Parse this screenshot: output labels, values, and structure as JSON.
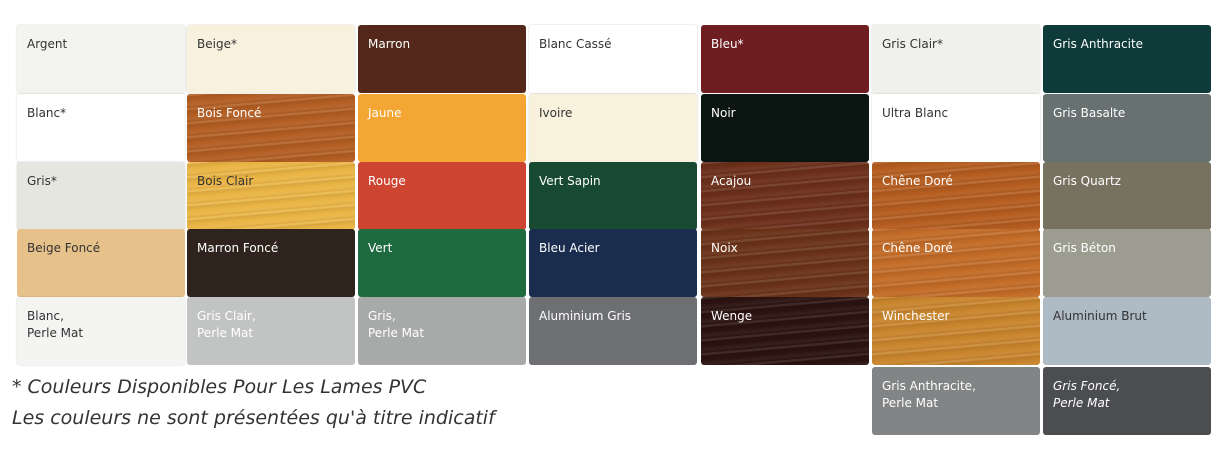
{
  "note": {
    "line1": "* Couleurs Disponibles Pour Les Lames PVC",
    "line2": "Les couleurs ne sont présentées qu'à titre indicatif"
  },
  "swatches": [
    {
      "label": "Argent",
      "color": "#f3f3f0",
      "text": "#333333",
      "col": 0,
      "row": 0,
      "light": true
    },
    {
      "label": "Beige*",
      "color": "#f8f1dd",
      "text": "#333333",
      "col": 1,
      "row": 0,
      "light": true
    },
    {
      "label": "Marron",
      "color": "#53281b",
      "text": "#ffffff",
      "col": 2,
      "row": 0
    },
    {
      "label": "Blanc Cassé",
      "color": "#ffffff",
      "text": "#333333",
      "col": 3,
      "row": 0,
      "light": true
    },
    {
      "label": "Bleu*",
      "color": "#6e1e21",
      "text": "#ffffff",
      "col": 4,
      "row": 0
    },
    {
      "label": "Gris Clair*",
      "color": "#f0f0ec",
      "text": "#333333",
      "col": 5,
      "row": 0,
      "light": true
    },
    {
      "label": "Gris Anthracite",
      "color": "#0e3a3a",
      "text": "#ffffff",
      "col": 6,
      "row": 0
    },
    {
      "label": "Blanc*",
      "color": "#ffffff",
      "text": "#333333",
      "col": 0,
      "row": 1,
      "light": true
    },
    {
      "label": "Bois Foncé",
      "color": "#b25d22",
      "text": "#ffffff",
      "col": 1,
      "row": 1,
      "wood": true
    },
    {
      "label": "Jaune",
      "color": "#f3a634",
      "text": "#ffffff",
      "col": 2,
      "row": 1
    },
    {
      "label": "Ivoire",
      "color": "#f8f2dd",
      "text": "#333333",
      "col": 3,
      "row": 1,
      "light": true
    },
    {
      "label": "Noir",
      "color": "#0b1613",
      "text": "#ffffff",
      "col": 4,
      "row": 1
    },
    {
      "label": "Ultra Blanc",
      "color": "#ffffff",
      "text": "#333333",
      "col": 5,
      "row": 1,
      "light": true
    },
    {
      "label": "Gris Basalte",
      "color": "#667170",
      "text": "#ffffff",
      "col": 6,
      "row": 1
    },
    {
      "label": "Gris*",
      "color": "#e4e6df",
      "text": "#333333",
      "col": 0,
      "row": 2,
      "light": true
    },
    {
      "label": "Bois Clair",
      "color": "#e9b444",
      "text": "#333333",
      "col": 1,
      "row": 2,
      "wood": true
    },
    {
      "label": "Rouge",
      "color": "#cd4530",
      "text": "#ffffff",
      "col": 2,
      "row": 2
    },
    {
      "label": "Vert Sapin",
      "color": "#184a32",
      "text": "#ffffff",
      "col": 3,
      "row": 2
    },
    {
      "label": "Acajou",
      "color": "#6b2f1a",
      "text": "#ffffff",
      "col": 4,
      "row": 2,
      "wood": true
    },
    {
      "label": "Chêne Doré",
      "color": "#b45c1f",
      "text": "#ffffff",
      "col": 5,
      "row": 2,
      "wood": true
    },
    {
      "label": "Gris Quartz",
      "color": "#76725f",
      "text": "#ffffff",
      "col": 6,
      "row": 2
    },
    {
      "label": "Beige Foncé",
      "color": "#e6c18a",
      "text": "#333333",
      "col": 0,
      "row": 3
    },
    {
      "label": "Marron Foncé",
      "color": "#2e241d",
      "text": "#ffffff",
      "col": 1,
      "row": 3
    },
    {
      "label": "Vert",
      "color": "#1e6b3f",
      "text": "#ffffff",
      "col": 2,
      "row": 3
    },
    {
      "label": "Bleu Acier",
      "color": "#1b2d4e",
      "text": "#ffffff",
      "col": 3,
      "row": 3
    },
    {
      "label": "Noix",
      "color": "#6a3218",
      "text": "#ffffff",
      "col": 4,
      "row": 3,
      "wood": true
    },
    {
      "label": "Chêne Doré",
      "color": "#c26b27",
      "text": "#ffffff",
      "col": 5,
      "row": 3,
      "wood": true
    },
    {
      "label": "Gris Béton",
      "color": "#9c9d90",
      "text": "#ffffff",
      "col": 6,
      "row": 3
    },
    {
      "label": "Blanc,\nPerle Mat",
      "color": "#f4f5f2",
      "text": "#333333",
      "col": 0,
      "row": 4,
      "light": true
    },
    {
      "label": "Gris Clair,\nPerle Mat",
      "color": "#c2c4c3",
      "text": "#ffffff",
      "col": 1,
      "row": 4
    },
    {
      "label": "Gris,\nPerle Mat",
      "color": "#a8aaa9",
      "text": "#ffffff",
      "col": 2,
      "row": 4
    },
    {
      "label": "Aluminium Gris",
      "color": "#6d6f72",
      "text": "#ffffff",
      "col": 3,
      "row": 4
    },
    {
      "label": "Wenge",
      "color": "#2a1210",
      "text": "#ffffff",
      "col": 4,
      "row": 4,
      "wood": true
    },
    {
      "label": "Winchester",
      "color": "#c8842c",
      "text": "#ffffff",
      "col": 5,
      "row": 4,
      "wood": true
    },
    {
      "label": "Aluminium Brut",
      "color": "#aebac4",
      "text": "#333333",
      "col": 6,
      "row": 4
    },
    {
      "label": "Gris Anthracite,\nPerle Mat",
      "color": "#828485",
      "text": "#ffffff",
      "col": 5,
      "row": 5
    },
    {
      "label": "Gris Foncé,\nPerle Mat",
      "color": "#4b4d50",
      "text": "#ffffff",
      "col": 6,
      "row": 5,
      "italic": true
    }
  ]
}
